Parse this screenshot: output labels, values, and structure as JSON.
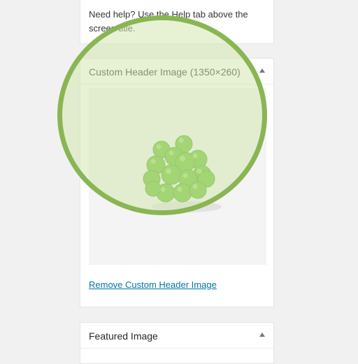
{
  "help_panel": {
    "text": "Need help? Use the Help tab above the screen title."
  },
  "header_panel": {
    "title": "Custom Header Image (1350×260)",
    "toggle_icon": "caret-up-icon",
    "image_subject": "green-peas-image",
    "remove_link": "Remove Custom Header Image"
  },
  "featured_panel": {
    "title": "Featured Image",
    "toggle_icon": "caret-up-icon"
  },
  "colors": {
    "page_bg": "#f1f1f1",
    "panel_bg": "#ffffff",
    "link": "#0073aa",
    "magnifier_ring": "#8ab553",
    "magnifier_fill": "#d4e8b2",
    "pea": "#6abf2c"
  }
}
